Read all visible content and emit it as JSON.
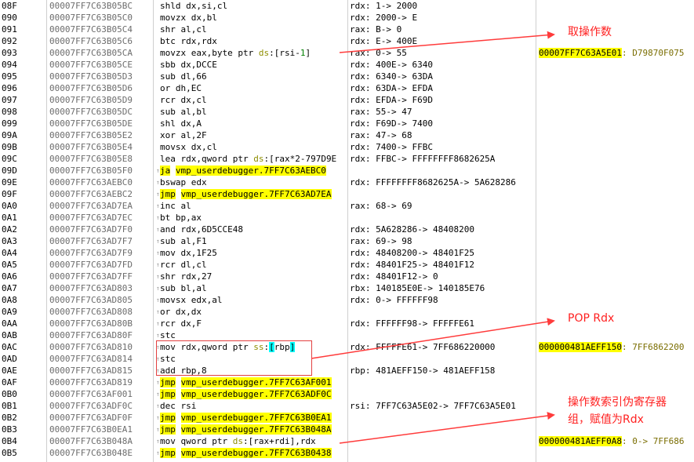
{
  "rows": [
    {
      "idx": "08F",
      "addr": "00007FF7C63B05BC",
      "ins": [
        {
          "t": "shld dx,si,cl"
        }
      ],
      "info": "rdx: 1-> 2000"
    },
    {
      "idx": "090",
      "addr": "00007FF7C63B05C0",
      "ins": [
        {
          "t": "movzx dx,bl"
        }
      ],
      "info": "rdx: 2000-> E"
    },
    {
      "idx": "091",
      "addr": "00007FF7C63B05C4",
      "ins": [
        {
          "t": "shr al,cl"
        }
      ],
      "info": "rax: B-> 0"
    },
    {
      "idx": "092",
      "addr": "00007FF7C63B05C6",
      "ins": [
        {
          "t": "btc rdx,rdx"
        }
      ],
      "info": "rdx: E-> 400E"
    },
    {
      "idx": "093",
      "addr": "00007FF7C63B05CA",
      "ins": [
        {
          "t": "movzx eax,byte ptr "
        },
        {
          "t": "ds",
          "c": "seg"
        },
        {
          "t": ":[rsi-"
        },
        {
          "t": "1",
          "c": "num"
        },
        {
          "t": "]"
        }
      ],
      "info": "rax: 0-> 55",
      "mem_addr": "00007FF7C63A5E01",
      "mem_val": ": D79870F075"
    },
    {
      "idx": "094",
      "addr": "00007FF7C63B05CE",
      "ins": [
        {
          "t": "sbb dx,DCCE"
        }
      ],
      "info": "rdx: 400E-> 6340"
    },
    {
      "idx": "095",
      "addr": "00007FF7C63B05D3",
      "ins": [
        {
          "t": "sub dl,66"
        }
      ],
      "info": "rdx: 6340-> 63DA"
    },
    {
      "idx": "096",
      "addr": "00007FF7C63B05D6",
      "ins": [
        {
          "t": "or dh,EC"
        }
      ],
      "info": "rdx: 63DA-> EFDA"
    },
    {
      "idx": "097",
      "addr": "00007FF7C63B05D9",
      "ins": [
        {
          "t": "rcr dx,cl"
        }
      ],
      "info": "rdx: EFDA-> F69D"
    },
    {
      "idx": "098",
      "addr": "00007FF7C63B05DC",
      "ins": [
        {
          "t": "sub al,bl"
        }
      ],
      "info": "rax: 55-> 47"
    },
    {
      "idx": "099",
      "addr": "00007FF7C63B05DE",
      "ins": [
        {
          "t": "shl dx,A"
        }
      ],
      "info": "rdx: F69D-> 7400"
    },
    {
      "idx": "09A",
      "addr": "00007FF7C63B05E2",
      "ins": [
        {
          "t": "xor al,2F"
        }
      ],
      "info": "rax: 47-> 68"
    },
    {
      "idx": "09B",
      "addr": "00007FF7C63B05E4",
      "ins": [
        {
          "t": "movsx dx,cl"
        }
      ],
      "info": "rdx: 7400-> FFBC"
    },
    {
      "idx": "09C",
      "addr": "00007FF7C63B05E8",
      "ins": [
        {
          "t": "lea rdx,qword ptr "
        },
        {
          "t": "ds",
          "c": "seg"
        },
        {
          "t": ":[rax*2-797D9E"
        }
      ],
      "info": "rdx: FFBC-> FFFFFFFF8682625A"
    },
    {
      "idx": "09D",
      "addr": "00007FF7C63B05F0",
      "ins": [
        {
          "t": "ja",
          "c": "hl"
        },
        {
          "t": " "
        },
        {
          "t": "vmp_userdebugger.7FF7C63AEBC0",
          "c": "hl"
        }
      ],
      "info": ""
    },
    {
      "idx": "09E",
      "addr": "00007FF7C63AEBC0",
      "ins": [
        {
          "t": "bswap edx"
        }
      ],
      "info": "rdx: FFFFFFFF8682625A-> 5A628286"
    },
    {
      "idx": "09F",
      "addr": "00007FF7C63AEBC2",
      "ins": [
        {
          "t": "jmp",
          "c": "hl"
        },
        {
          "t": " "
        },
        {
          "t": "vmp_userdebugger.7FF7C63AD7EA",
          "c": "hl"
        }
      ],
      "info": ""
    },
    {
      "idx": "0A0",
      "addr": "00007FF7C63AD7EA",
      "ins": [
        {
          "t": "inc al"
        }
      ],
      "info": "rax: 68-> 69"
    },
    {
      "idx": "0A1",
      "addr": "00007FF7C63AD7EC",
      "ins": [
        {
          "t": "bt bp,ax"
        }
      ],
      "info": ""
    },
    {
      "idx": "0A2",
      "addr": "00007FF7C63AD7F0",
      "ins": [
        {
          "t": "and rdx,6D5CCE48"
        }
      ],
      "info": "rdx: 5A628286-> 48408200"
    },
    {
      "idx": "0A3",
      "addr": "00007FF7C63AD7F7",
      "ins": [
        {
          "t": "sub al,F1"
        }
      ],
      "info": "rax: 69-> 98"
    },
    {
      "idx": "0A4",
      "addr": "00007FF7C63AD7F9",
      "ins": [
        {
          "t": "mov dx,1F25"
        }
      ],
      "info": "rdx: 48408200-> 48401F25"
    },
    {
      "idx": "0A5",
      "addr": "00007FF7C63AD7FD",
      "ins": [
        {
          "t": "rcr dl,cl"
        }
      ],
      "info": "rdx: 48401F25-> 48401F12"
    },
    {
      "idx": "0A6",
      "addr": "00007FF7C63AD7FF",
      "ins": [
        {
          "t": "shr rdx,27"
        }
      ],
      "info": "rdx: 48401F12-> 0"
    },
    {
      "idx": "0A7",
      "addr": "00007FF7C63AD803",
      "ins": [
        {
          "t": "sub bl,al"
        }
      ],
      "info": "rbx: 140185E0E-> 140185E76"
    },
    {
      "idx": "0A8",
      "addr": "00007FF7C63AD805",
      "ins": [
        {
          "t": "movsx edx,al"
        }
      ],
      "info": "rdx: 0-> FFFFFF98"
    },
    {
      "idx": "0A9",
      "addr": "00007FF7C63AD808",
      "ins": [
        {
          "t": "or dx,dx"
        }
      ],
      "info": ""
    },
    {
      "idx": "0AA",
      "addr": "00007FF7C63AD80B",
      "ins": [
        {
          "t": "rcr dx,F"
        }
      ],
      "info": "rdx: FFFFFF98-> FFFFFE61"
    },
    {
      "idx": "0AB",
      "addr": "00007FF7C63AD80F",
      "ins": [
        {
          "t": "stc"
        }
      ],
      "info": ""
    },
    {
      "idx": "0AC",
      "addr": "00007FF7C63AD810",
      "ins": [
        {
          "t": "mov rdx,qword ptr "
        },
        {
          "t": "ss",
          "c": "seg"
        },
        {
          "t": ":"
        },
        {
          "t": "[",
          "c": "hl2"
        },
        {
          "t": "rbp"
        },
        {
          "t": "]",
          "c": "hl2"
        }
      ],
      "info": "rdx: FFFFFE61-> 7FF686220000",
      "mem_addr": "000000481AEFF150",
      "mem_val": ": 7FF6862200"
    },
    {
      "idx": "0AD",
      "addr": "00007FF7C63AD814",
      "ins": [
        {
          "t": "stc"
        }
      ],
      "info": ""
    },
    {
      "idx": "0AE",
      "addr": "00007FF7C63AD815",
      "ins": [
        {
          "t": "add rbp,8"
        }
      ],
      "info": "rbp: 481AEFF150-> 481AEFF158"
    },
    {
      "idx": "0AF",
      "addr": "00007FF7C63AD819",
      "ins": [
        {
          "t": "jmp",
          "c": "hl"
        },
        {
          "t": " "
        },
        {
          "t": "vmp_userdebugger.7FF7C63AF001",
          "c": "hl"
        }
      ],
      "info": ""
    },
    {
      "idx": "0B0",
      "addr": "00007FF7C63AF001",
      "ins": [
        {
          "t": "jmp",
          "c": "hl"
        },
        {
          "t": " "
        },
        {
          "t": "vmp_userdebugger.7FF7C63ADF0C",
          "c": "hl"
        }
      ],
      "info": ""
    },
    {
      "idx": "0B1",
      "addr": "00007FF7C63ADF0C",
      "ins": [
        {
          "t": "dec rsi"
        }
      ],
      "info": "rsi: 7FF7C63A5E02-> 7FF7C63A5E01"
    },
    {
      "idx": "0B2",
      "addr": "00007FF7C63ADF0F",
      "ins": [
        {
          "t": "jmp",
          "c": "hl"
        },
        {
          "t": " "
        },
        {
          "t": "vmp_userdebugger.7FF7C63B0EA1",
          "c": "hl"
        }
      ],
      "info": ""
    },
    {
      "idx": "0B3",
      "addr": "00007FF7C63B0EA1",
      "ins": [
        {
          "t": "jmp",
          "c": "hl"
        },
        {
          "t": " "
        },
        {
          "t": "vmp_userdebugger.7FF7C63B048A",
          "c": "hl"
        }
      ],
      "info": ""
    },
    {
      "idx": "0B4",
      "addr": "00007FF7C63B048A",
      "ins": [
        {
          "t": "mov qword ptr "
        },
        {
          "t": "ds",
          "c": "seg"
        },
        {
          "t": ":[rax+rdi],rdx"
        }
      ],
      "info": "",
      "mem_addr": "000000481AEFF0A8",
      "mem_val": ": 0-> 7FF686"
    },
    {
      "idx": "0B5",
      "addr": "00007FF7C63B048E",
      "ins": [
        {
          "t": "jmp",
          "c": "hl"
        },
        {
          "t": " "
        },
        {
          "t": "vmp_userdebugger.7FF7C63B0438",
          "c": "hl"
        }
      ],
      "info": ""
    }
  ],
  "annotations": {
    "fetch_operand": "取操作数",
    "pop_rdx": "POP Rdx",
    "assign_line1": "操作数索引伪寄存器",
    "assign_line2": "组，赋值为Rdx"
  },
  "colors": {
    "arrow": "#ff3b3b",
    "highlight": "#ffff00",
    "bracket": "#00ffff"
  }
}
